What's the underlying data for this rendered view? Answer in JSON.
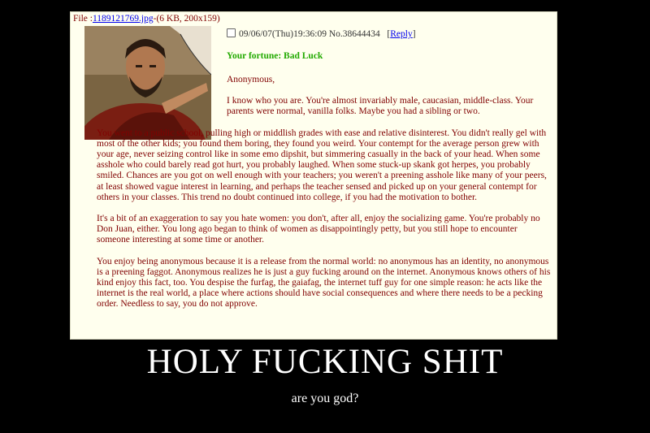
{
  "post": {
    "file_prefix": "File :",
    "file_link": "1189121769.jpg",
    "file_suffix": "-(6 KB, 200x159)",
    "datetime": "09/06/07(Thu)19:36:09",
    "post_number": "No.38644434",
    "reply_label": "Reply",
    "fortune": "Your fortune: Bad Luck",
    "name": "Anonymous,",
    "paragraphs": [
      "I know who you are. You're almost invariably male, caucasian, middle-class. Your parents were normal, vanilla folks. Maybe you had a sibling or two.",
      "You went to a public school, pulling high or middlish grades with ease and relative disinterest. You didn't really gel with most of the other kids; you found them boring, they found you weird. Your contempt for the average person grew with your age, never seizing control like in some emo dipshit, but simmering casually in the back of your head. When some asshole who could barely read got hurt, you probably laughed. When some stuck-up skank got herpes, you probably smiled. Chances are you got on well enough with your teachers; you weren't a preening asshole like many of your peers, at least showed vague interest in learning, and perhaps the teacher sensed and picked up on your general contempt for others in your classes. This trend no doubt continued into college, if you had the motivation to bother.",
      "It's a bit of an exaggeration to say you hate women: you don't, after all, enjoy the socializing game. You're probably no Don Juan, either. You long ago began to think of women as disappointingly petty, but you still hope to encounter someone interesting at some time or another.",
      "You enjoy being anonymous because it is a release from the normal world: no anonymous has an identity, no anonymous is a preening faggot. Anonymous realizes he is just a guy fucking around on the internet. Anonymous knows others of his kind enjoy this fact, too. You despise the furfag, the gaiafag, the internet tuff guy for one simple reason: he acts like the internet is the real world, a place where actions should have social consequences and where there needs to be a pecking order. Needless to say, you do not approve."
    ]
  },
  "poster": {
    "title": "HOLY FUCKING SHIT",
    "subtitle": "are you god?"
  },
  "colors": {
    "background": "#000000",
    "post_bg": "#ffffee",
    "post_text": "#800000",
    "fortune": "#22aa00",
    "link": "#0000ee"
  }
}
